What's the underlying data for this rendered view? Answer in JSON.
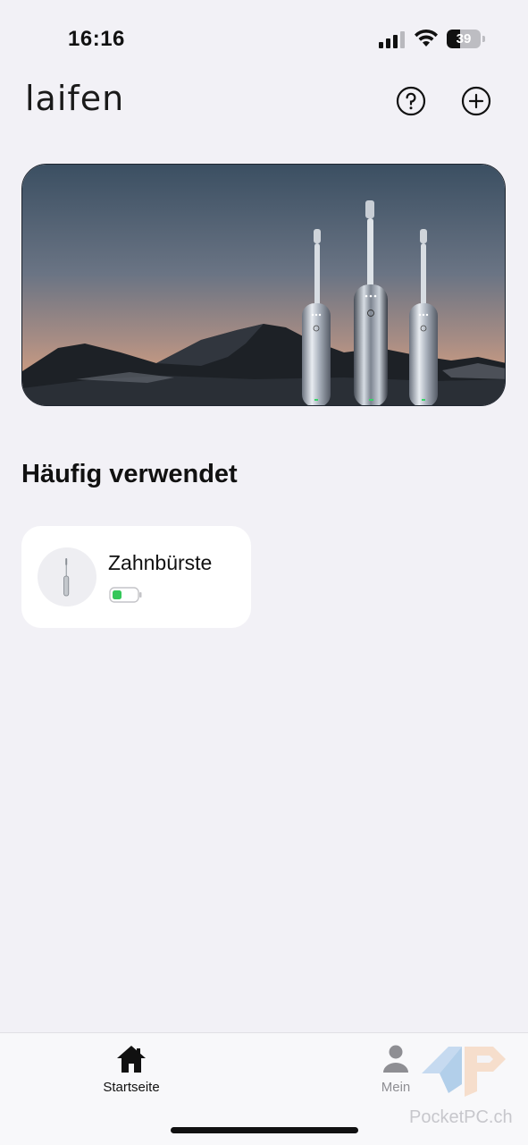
{
  "status_bar": {
    "time": "16:16",
    "battery_level": "39",
    "battery_fraction": 0.39
  },
  "header": {
    "logo": "laifen",
    "help_icon": "help-circle-icon",
    "add_icon": "plus-circle-icon"
  },
  "banner": {
    "image": "toothbrush-promo-banner"
  },
  "section": {
    "title": "Häufig verwendet"
  },
  "devices": [
    {
      "name": "Zahnbürste",
      "icon": "toothbrush-icon",
      "battery_status": "battery-low-green"
    }
  ],
  "tabs": [
    {
      "label": "Startseite",
      "icon": "home-icon",
      "active": true
    },
    {
      "label": "Mein",
      "icon": "person-icon",
      "active": false
    }
  ],
  "watermark": {
    "text": "PocketPC.ch"
  },
  "colors": {
    "background": "#f2f1f6",
    "card": "#ffffff",
    "battery_green": "#34c759",
    "tab_inactive": "#8e8e93"
  }
}
